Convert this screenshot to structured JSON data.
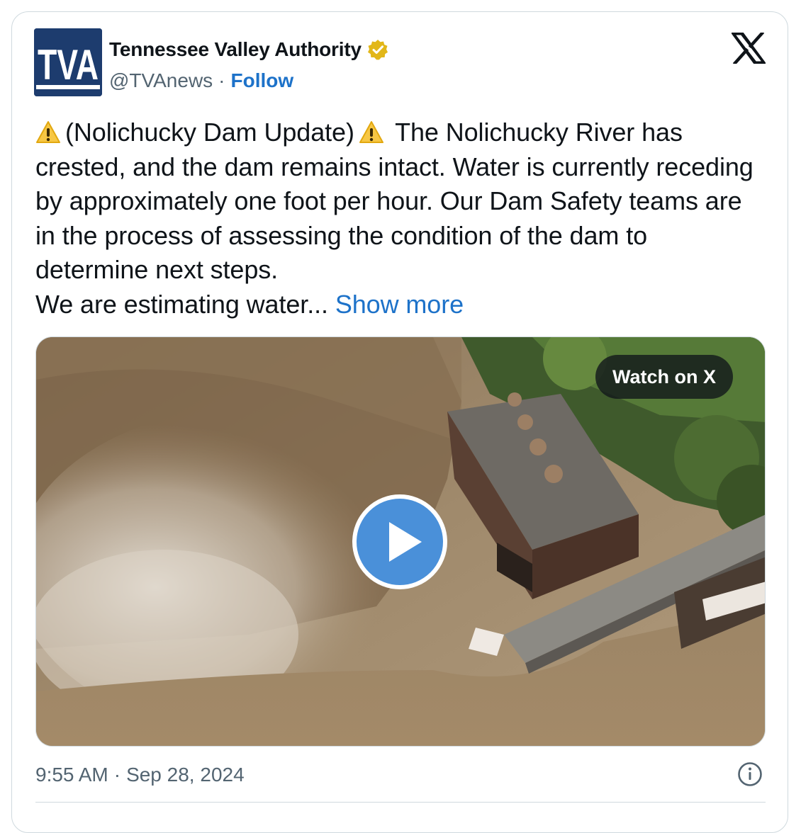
{
  "account": {
    "logo_text": "TVA",
    "display_name": "Tennessee Valley Authority",
    "handle": "@TVAnews",
    "separator": "·",
    "follow_label": "Follow",
    "verified_badge": "verified-gold-icon"
  },
  "platform_icon": "x-logo-icon",
  "tweet": {
    "line1_open": "(Nolichucky Dam Update)",
    "line1_rest": " The Nolichucky River has crested, and the dam remains intact. Water is currently receding by approximately one foot per hour. Our Dam Safety teams are in the process of assessing the condition of the dam to determine next steps.",
    "line2": "We are estimating water...",
    "show_more": "Show more"
  },
  "media": {
    "watch_label": "Watch on X",
    "play_icon": "play-icon"
  },
  "footer": {
    "time": "9:55 AM",
    "separator": "·",
    "date": "Sep 28, 2024",
    "info_icon": "info-icon"
  },
  "colors": {
    "link": "#1d72c9",
    "text": "#0f1419",
    "muted": "#536471",
    "logo_bg": "#1d3c6e"
  }
}
